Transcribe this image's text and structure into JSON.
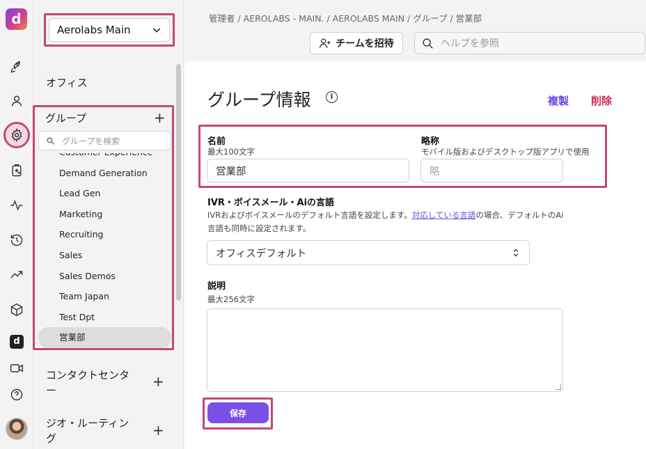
{
  "app": {
    "logo_letter": "d",
    "accent": "#7a4fe8",
    "highlight": "#c2477a"
  },
  "rail": {
    "items": [
      {
        "icon": "rocket-icon"
      },
      {
        "icon": "person-icon"
      },
      {
        "icon": "gear-icon",
        "active": true
      },
      {
        "icon": "clipboard-sparkle-icon"
      },
      {
        "icon": "activity-icon"
      },
      {
        "icon": "history-icon"
      },
      {
        "icon": "trend-icon"
      },
      {
        "icon": "cube-icon"
      },
      {
        "icon": "d-app-icon",
        "label": "d"
      },
      {
        "icon": "video-icon"
      },
      {
        "icon": "help-icon"
      }
    ]
  },
  "sidebar": {
    "workspace": "Aerolabs Main",
    "office_label": "オフィス",
    "groups_label": "グループ",
    "group_search_placeholder": "グループを検索",
    "groups": [
      "Customer Experience",
      "Demand Generation",
      "Lead Gen",
      "Marketing",
      "Recruiting",
      "Sales",
      "Sales Demos",
      "Team Japan",
      "Test Dpt",
      "営業部"
    ],
    "selected_group": "営業部",
    "contact_center_label_1": "コンタクトセンタ",
    "contact_center_label_2": "ー",
    "geo_routing_label_1": "ジオ・ルーティン",
    "geo_routing_label_2": "グ"
  },
  "header": {
    "breadcrumb": "管理者 / AEROLABS - MAIN. / AEROLABS MAIN / グループ / 営業部",
    "invite_label": "チームを招待",
    "help_placeholder": "ヘルプを参照"
  },
  "main": {
    "title": "グループ情報",
    "info_glyph": "i",
    "duplicate_label": "複製",
    "delete_label": "削除",
    "name_label": "名前",
    "name_hint": "最大100文字",
    "name_value": "営業部",
    "abbr_label": "略称",
    "abbr_hint": "モバイル版およびデスクトップ版アプリで使用",
    "abbr_placeholder": "略",
    "lang_label": "IVR・ボイスメール・Aiの言語",
    "lang_desc_1": "IVRおよびボイスメールのデフォルト言語を設定します。",
    "lang_desc_link": "対応している言語",
    "lang_desc_2": "の場合、デフォルトのAi言語も同時に設定されます。",
    "lang_value": "オフィスデフォルト",
    "desc_label": "説明",
    "desc_hint": "最大256文字",
    "save_label": "保存"
  }
}
